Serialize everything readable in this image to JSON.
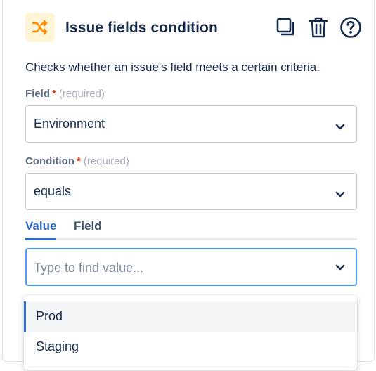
{
  "header": {
    "title": "Issue fields condition",
    "icon": "shuffle-icon",
    "icon_bg": "#fff4d6",
    "icon_color": "#ff8b00",
    "actions": [
      {
        "name": "duplicate-icon",
        "label": "Duplicate"
      },
      {
        "name": "trash-icon",
        "label": "Delete"
      },
      {
        "name": "help-icon",
        "label": "Help"
      }
    ]
  },
  "description": "Checks whether an issue's field meets a certain criteria.",
  "field": {
    "label": "Field",
    "required_mark": "*",
    "hint": "(required)",
    "value": "Environment"
  },
  "condition": {
    "label": "Condition",
    "required_mark": "*",
    "hint": "(required)",
    "value": "equals"
  },
  "tabs": [
    {
      "label": "Value",
      "active": true
    },
    {
      "label": "Field",
      "active": false
    }
  ],
  "value_search": {
    "placeholder": "Type to find value..."
  },
  "dropdown": {
    "options": [
      {
        "label": "Prod",
        "highlighted": true
      },
      {
        "label": "Staging",
        "highlighted": false
      }
    ]
  },
  "colors": {
    "accent": "#2b6bd6",
    "focus_border": "#4c9aff",
    "required": "#de350b"
  }
}
